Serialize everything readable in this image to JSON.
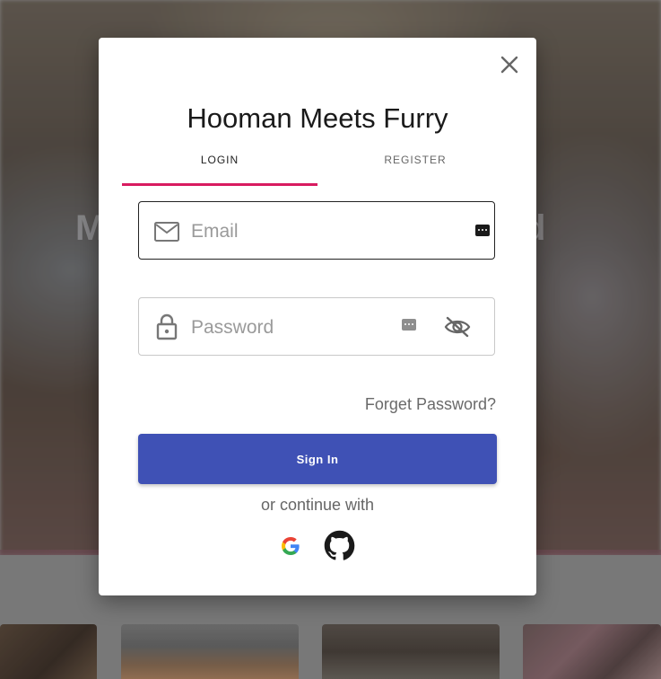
{
  "background": {
    "hero_text_left": "M",
    "hero_text_right": "d"
  },
  "modal": {
    "title": "Hooman Meets Furry",
    "close_icon": "close-icon",
    "tabs": [
      {
        "label": "LOGIN",
        "active": true
      },
      {
        "label": "REGISTER",
        "active": false
      }
    ],
    "accent_color": "#d81b60",
    "email": {
      "placeholder": "Email",
      "value": "",
      "icon": "mail-icon"
    },
    "password": {
      "placeholder": "Password",
      "value": "",
      "icon": "lock-icon",
      "toggle_icon": "eye-off-icon"
    },
    "forgot_label": "Forget Password?",
    "signin_label": "Sign In",
    "signin_color": "#3f51b5",
    "or_continue": "or continue with",
    "providers": [
      {
        "name": "Google",
        "icon": "google-icon"
      },
      {
        "name": "GitHub",
        "icon": "github-icon"
      }
    ]
  }
}
